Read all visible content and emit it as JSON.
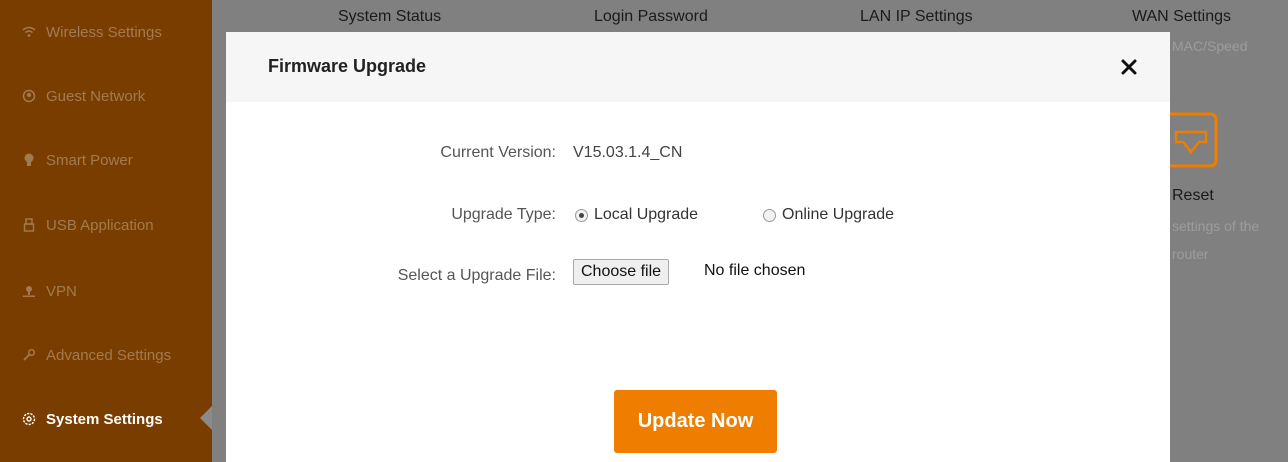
{
  "sidebar": {
    "items": [
      {
        "label": "Wireless Settings",
        "icon": "wifi-icon"
      },
      {
        "label": "Guest Network",
        "icon": "guest-icon"
      },
      {
        "label": "Smart Power",
        "icon": "bulb-icon"
      },
      {
        "label": "USB Application",
        "icon": "usb-icon"
      },
      {
        "label": "VPN",
        "icon": "vpn-icon"
      },
      {
        "label": "Advanced Settings",
        "icon": "wrench-icon"
      },
      {
        "label": "System Settings",
        "icon": "gear-icon",
        "active": true
      }
    ]
  },
  "background": {
    "tabs": [
      "System Status",
      "Login Password",
      "LAN IP Settings",
      "WAN Settings"
    ],
    "wan_sub": "MAC/Speed",
    "reset": {
      "title": "Reset",
      "line1": "settings of the",
      "line2": "router"
    }
  },
  "modal": {
    "title": "Firmware Upgrade",
    "close_icon": "close-icon",
    "current_version_label": "Current Version:",
    "current_version_value": "V15.03.1.4_CN",
    "upgrade_type_label": "Upgrade Type:",
    "upgrade_options": [
      {
        "label": "Local Upgrade",
        "checked": true
      },
      {
        "label": "Online Upgrade",
        "checked": false
      }
    ],
    "file_label": "Select a Upgrade File:",
    "file_button": "Choose file",
    "file_status": "No file chosen",
    "update_button": "Update Now"
  },
  "colors": {
    "accent": "#ee7d00",
    "sidebar": "#7a3d00",
    "overlay": "#808080"
  }
}
